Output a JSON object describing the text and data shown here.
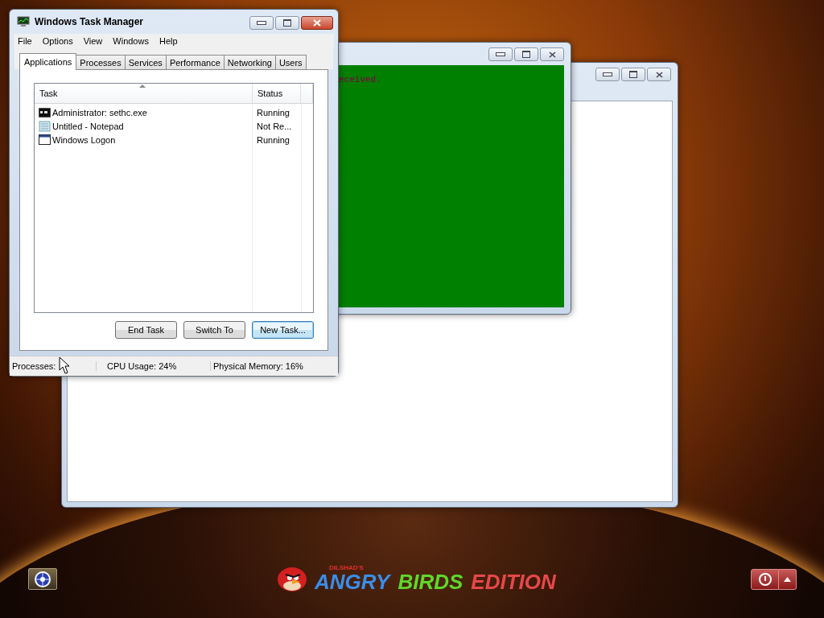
{
  "task_manager": {
    "title": "Windows Task Manager",
    "menu": [
      "File",
      "Options",
      "View",
      "Windows",
      "Help"
    ],
    "tabs": [
      {
        "label": "Applications",
        "selected": true
      },
      {
        "label": "Processes",
        "selected": false
      },
      {
        "label": "Services",
        "selected": false
      },
      {
        "label": "Performance",
        "selected": false
      },
      {
        "label": "Networking",
        "selected": false
      },
      {
        "label": "Users",
        "selected": false
      }
    ],
    "columns": [
      "Task",
      "Status"
    ],
    "rows": [
      {
        "kind": "console",
        "task": "Administrator: sethc.exe",
        "status": "Running"
      },
      {
        "kind": "notepad",
        "task": "Untitled - Notepad",
        "status": "Not Re..."
      },
      {
        "kind": "window",
        "task": "Windows Logon",
        "status": "Running"
      }
    ],
    "buttons": [
      {
        "label": "End Task",
        "focused": false
      },
      {
        "label": "Switch To",
        "focused": false
      },
      {
        "label": "New Task...",
        "focused": true
      }
    ],
    "status_bar": [
      "Processes:",
      "CPU Usage: 24%",
      "Physical Memory: 16%"
    ]
  },
  "console_window": {
    "text": "eceived."
  },
  "logon": {
    "brand_small": "DILSHAD'S",
    "brand_words": [
      {
        "text": "ANGRY",
        "color": "#3a8ee8"
      },
      {
        "text": "BIRDS",
        "color": "#5fd82a"
      },
      {
        "text": "EDITION",
        "color": "#e84848"
      }
    ]
  }
}
